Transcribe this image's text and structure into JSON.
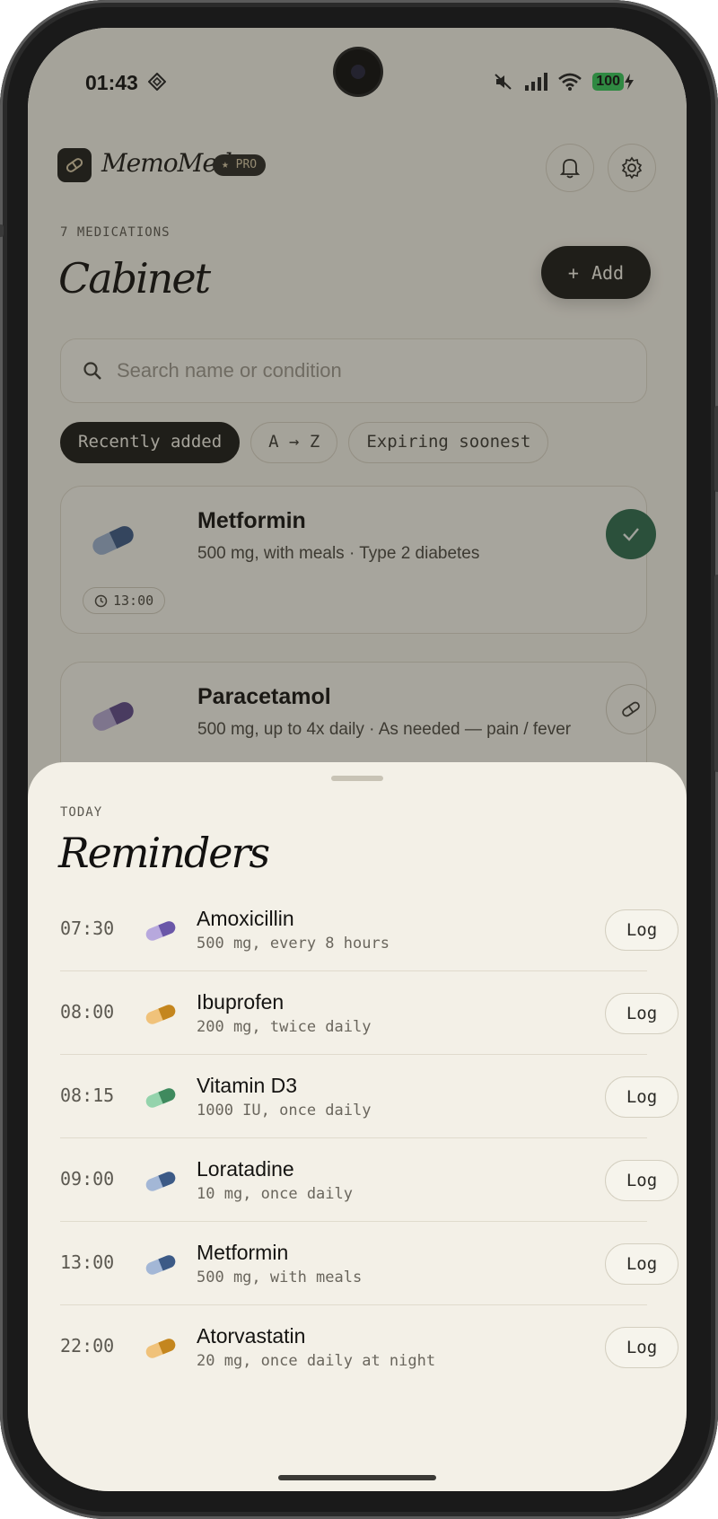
{
  "status_bar": {
    "time": "01:43",
    "battery": "100"
  },
  "header": {
    "app_name": "MemoMed",
    "pro_label": "PRO"
  },
  "cabinet": {
    "count_label": "7 MEDICATIONS",
    "title": "Cabinet",
    "add_label": "Add",
    "search_placeholder": "Search name or condition",
    "sort_chips": [
      "Recently added",
      "A → Z",
      "Expiring soonest"
    ],
    "active_sort": "Recently added",
    "cards": [
      {
        "name": "Metformin",
        "desc": "500 mg, with meals · Type 2 diabetes",
        "time": "13:00",
        "taken": true,
        "pill_color": "#3c5a86"
      },
      {
        "name": "Paracetamol",
        "desc": "500 mg, up to 4x daily · As needed — pain / fever",
        "pill_color": "#5e4a8a"
      }
    ]
  },
  "reminders": {
    "overline": "TODAY",
    "title": "Reminders",
    "log_label": "Log",
    "items": [
      {
        "time": "07:30",
        "name": "Amoxicillin",
        "dose": "500 mg, every 8 hours",
        "pill_color": "#6a57a8"
      },
      {
        "time": "08:00",
        "name": "Ibuprofen",
        "dose": "200 mg, twice daily",
        "pill_color": "#c4861e"
      },
      {
        "time": "08:15",
        "name": "Vitamin D3",
        "dose": "1000 IU, once daily",
        "pill_color": "#3f8a5e"
      },
      {
        "time": "09:00",
        "name": "Loratadine",
        "dose": "10 mg, once daily",
        "pill_color": "#3c5a86"
      },
      {
        "time": "13:00",
        "name": "Metformin",
        "dose": "500 mg, with meals",
        "pill_color": "#3c5a86"
      },
      {
        "time": "22:00",
        "name": "Atorvastatin",
        "dose": "20 mg, once daily at night",
        "pill_color": "#c4861e"
      }
    ]
  }
}
